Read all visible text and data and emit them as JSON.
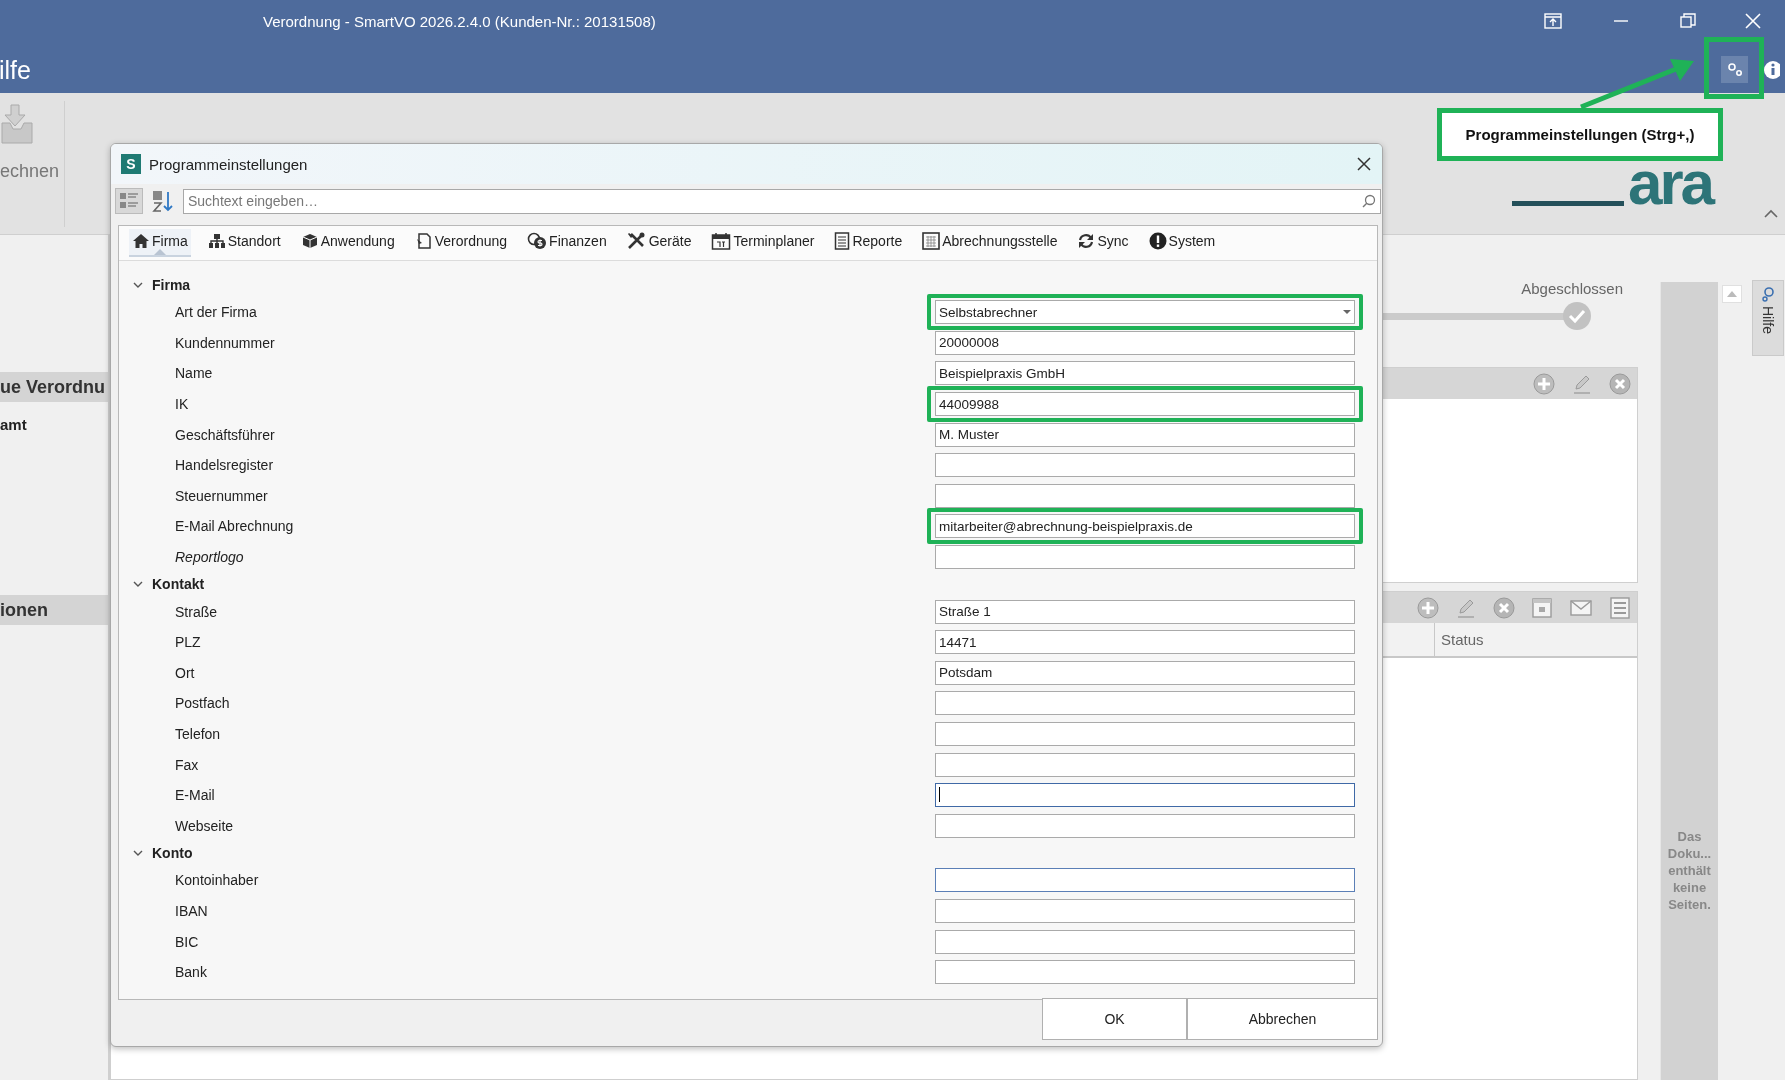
{
  "window": {
    "title": "Verordnung - SmartVO 2026.2.4.0 (Kunden-Nr.: 20131508)"
  },
  "menu_bar": {
    "item": "ilfe"
  },
  "ribbon": {
    "button_label": "echnen",
    "logo": "ara"
  },
  "left_panel": {
    "sections": [
      {
        "title": "ue Verordnu",
        "items": [
          "amt"
        ]
      },
      {
        "title": "ionen"
      }
    ]
  },
  "workspace": {
    "step": {
      "label": "Abgeschlossen",
      "done": true
    },
    "list_columns": [
      "Status"
    ]
  },
  "document_preview": {
    "message": "Das Doku... enthält keine Seiten."
  },
  "side_tab": {
    "label": "Hilfe"
  },
  "tooltip": {
    "text": "Programmeinstellungen (Strg+,)"
  },
  "dialog": {
    "title": "Programmeinstellungen",
    "app_badge": "S",
    "search": {
      "placeholder": "Suchtext eingeben…"
    },
    "tabs": [
      {
        "label": "Firma",
        "selected": true
      },
      {
        "label": "Standort",
        "selected": false
      },
      {
        "label": "Anwendung",
        "selected": false
      },
      {
        "label": "Verordnung",
        "selected": false
      },
      {
        "label": "Finanzen",
        "selected": false
      },
      {
        "label": "Geräte",
        "selected": false
      },
      {
        "label": "Terminplaner",
        "selected": false
      },
      {
        "label": "Reporte",
        "selected": false
      },
      {
        "label": "Abrechnungsstelle",
        "selected": false
      },
      {
        "label": "Sync",
        "selected": false
      },
      {
        "label": "System",
        "selected": false
      }
    ],
    "sections": [
      {
        "title": "Firma",
        "expanded": true,
        "rows": [
          {
            "label": "Art der Firma",
            "kind": "dropdown",
            "value": "Selbstabrechner",
            "highlighted": true,
            "focused": false,
            "hovered": false
          },
          {
            "label": "Kundennummer",
            "kind": "text",
            "value": "20000008",
            "highlighted": false,
            "focused": false,
            "hovered": false
          },
          {
            "label": "Name",
            "kind": "text",
            "value": "Beispielpraxis GmbH",
            "highlighted": false,
            "focused": false,
            "hovered": false
          },
          {
            "label": "IK",
            "kind": "text",
            "value": "44009988",
            "highlighted": true,
            "focused": false,
            "hovered": false
          },
          {
            "label": "Geschäftsführer",
            "kind": "text",
            "value": "M. Muster",
            "highlighted": false,
            "focused": false,
            "hovered": false
          },
          {
            "label": "Handelsregister",
            "kind": "text",
            "highlighted": false,
            "focused": false,
            "hovered": false
          },
          {
            "label": "Steuernummer",
            "kind": "text",
            "highlighted": false,
            "focused": false,
            "hovered": false
          },
          {
            "label": "E-Mail Abrechnung",
            "kind": "text",
            "value": "mitarbeiter@abrechnung-beispielpraxis.de",
            "highlighted": true,
            "focused": false,
            "hovered": false
          },
          {
            "label": "Reportlogo",
            "kind": "image",
            "highlighted": false,
            "focused": false,
            "hovered": false
          }
        ]
      },
      {
        "title": "Kontakt",
        "expanded": true,
        "rows": [
          {
            "label": "Straße",
            "kind": "text",
            "value": "Straße 1",
            "highlighted": false,
            "focused": false,
            "hovered": false
          },
          {
            "label": "PLZ",
            "kind": "text",
            "value": "14471",
            "highlighted": false,
            "focused": false,
            "hovered": false
          },
          {
            "label": "Ort",
            "kind": "text",
            "value": "Potsdam",
            "highlighted": false,
            "focused": false,
            "hovered": false
          },
          {
            "label": "Postfach",
            "kind": "text",
            "highlighted": false,
            "focused": false,
            "hovered": false
          },
          {
            "label": "Telefon",
            "kind": "text",
            "highlighted": false,
            "focused": false,
            "hovered": false
          },
          {
            "label": "Fax",
            "kind": "text",
            "highlighted": false,
            "focused": false,
            "hovered": false
          },
          {
            "label": "E-Mail",
            "kind": "text",
            "highlighted": false,
            "focused": true,
            "hovered": false
          },
          {
            "label": "Webseite",
            "kind": "text",
            "highlighted": false,
            "focused": false,
            "hovered": false
          }
        ]
      },
      {
        "title": "Konto",
        "expanded": true,
        "rows": [
          {
            "label": "Kontoinhaber",
            "kind": "text",
            "highlighted": false,
            "focused": false,
            "hovered": true
          },
          {
            "label": "IBAN",
            "kind": "text",
            "highlighted": false,
            "focused": false,
            "hovered": false
          },
          {
            "label": "BIC",
            "kind": "text",
            "highlighted": false,
            "focused": false,
            "hovered": false
          },
          {
            "label": "Bank",
            "kind": "text",
            "highlighted": false,
            "focused": false,
            "hovered": false
          }
        ]
      }
    ],
    "buttons": [
      "OK",
      "Abbrechen"
    ]
  }
}
